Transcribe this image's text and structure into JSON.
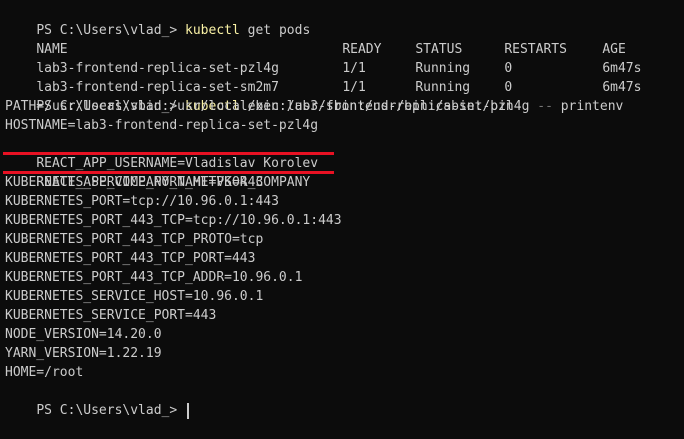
{
  "prompt": "PS C:\\Users\\vlad_> ",
  "cmd1": {
    "keyword": "kubectl",
    "args": " get pods"
  },
  "table": {
    "headers": [
      "NAME",
      "READY",
      "STATUS",
      "RESTARTS",
      "AGE"
    ],
    "rows": [
      [
        "lab3-frontend-replica-set-pzl4g",
        "1/1",
        "Running",
        "0",
        "6m47s"
      ],
      [
        "lab3-frontend-replica-set-sm2m7",
        "1/1",
        "Running",
        "0",
        "6m47s"
      ]
    ]
  },
  "cmd2": {
    "keyword": "kubectl",
    "args_a": " exec lab3-frontend-replica-set-pzl4g ",
    "flag": "--",
    "args_b": " printenv"
  },
  "env_lines": [
    "PATH=/usr/local/sbin:/usr/local/bin:/usr/sbin:/usr/bin:/sbin:/bin",
    "HOSTNAME=lab3-frontend-replica-set-pzl4g",
    "REACT_APP_USERNAME=Vladislav Korolev",
    "REACT_APP_COMPANY_NAME=VKOR_COMPANY",
    "KUBERNETES_SERVICE_PORT_HTTPS=443",
    "KUBERNETES_PORT=tcp://10.96.0.1:443",
    "KUBERNETES_PORT_443_TCP=tcp://10.96.0.1:443",
    "KUBERNETES_PORT_443_TCP_PROTO=tcp",
    "KUBERNETES_PORT_443_TCP_PORT=443",
    "KUBERNETES_PORT_443_TCP_ADDR=10.96.0.1",
    "KUBERNETES_SERVICE_HOST=10.96.0.1",
    "KUBERNETES_SERVICE_PORT=443",
    "NODE_VERSION=14.20.0",
    "YARN_VERSION=1.22.19",
    "HOME=/root"
  ],
  "colors": {
    "background": "#0c0c0c",
    "text": "#cccccc",
    "keyword": "#f9f1a5",
    "flag": "#767676",
    "highlight_underline": "#e81123"
  }
}
